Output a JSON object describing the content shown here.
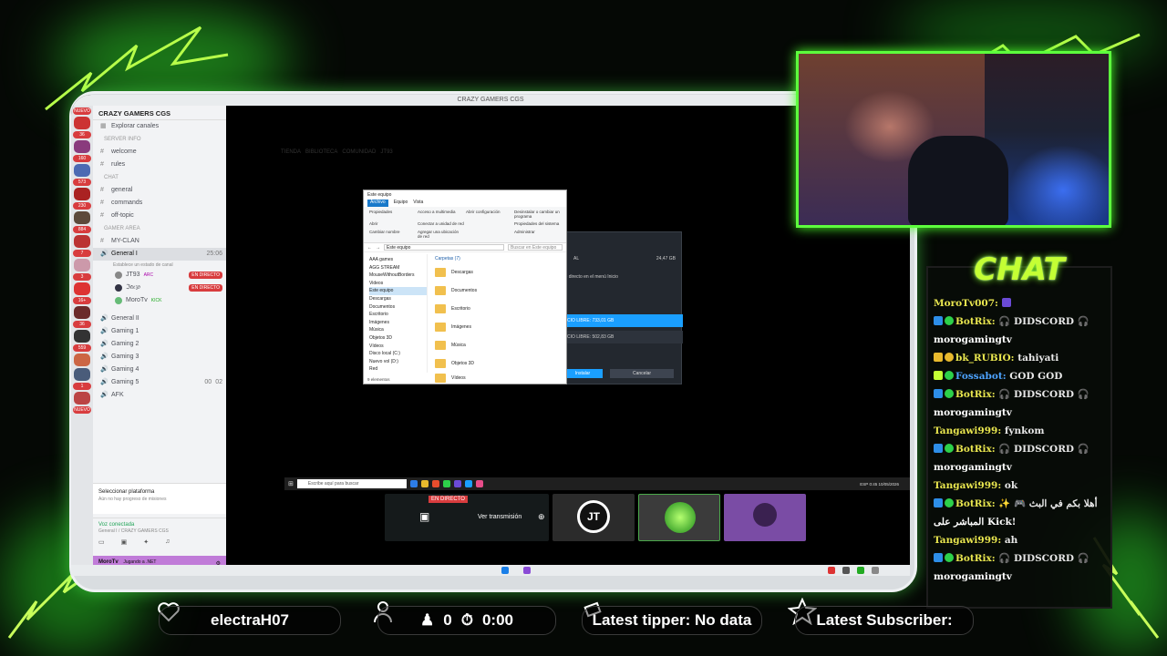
{
  "window_title": "CRAZY GAMERS CGS",
  "discord": {
    "rail_badges": [
      "NUEVO",
      "36",
      "160",
      "573",
      "230",
      "884",
      "7",
      "3",
      "16+",
      "36",
      "559",
      "1",
      "NUEVO"
    ],
    "server_name": "CRAZY GAMERS CGS",
    "explore": "Explorar canales",
    "channels": [
      {
        "kind": "cat",
        "label": "SERVER INFO"
      },
      {
        "kind": "text",
        "label": "welcome"
      },
      {
        "kind": "text",
        "label": "rules"
      },
      {
        "kind": "cat",
        "label": "CHAT"
      },
      {
        "kind": "text",
        "label": "general"
      },
      {
        "kind": "text",
        "label": "commands"
      },
      {
        "kind": "text",
        "label": "off-topic"
      },
      {
        "kind": "cat",
        "label": "GAMER AREA"
      },
      {
        "kind": "text",
        "label": "MY-CLAN"
      }
    ],
    "active_voice": {
      "label": "General I",
      "time": "25:06",
      "sub": "Establece un estado de canal"
    },
    "voice_users": [
      {
        "name": "JT93",
        "tag": "ARC",
        "live": "EN DIRECTO"
      },
      {
        "name": "ℑ𝔞𝔢𝔷𝔬",
        "tag": "",
        "live": "EN DIRECTO"
      },
      {
        "name": "MoroTv",
        "tag": "KICK",
        "live": ""
      }
    ],
    "voice_channels": [
      "General II",
      "Gaming 1",
      "Gaming 2",
      "Gaming 3",
      "Gaming 4",
      "Gaming 5",
      "AFK"
    ],
    "gaming5_counts": [
      "00",
      "02"
    ],
    "platform_title": "Seleccionar plataforma",
    "platform_sub": "Aún no hay progreso de misiones",
    "voice_connected": "Voz conectada",
    "voice_path": "General I / CRAZY GAMERS CGS",
    "user_name": "MoroTv",
    "user_status": "Jugando a .NET"
  },
  "explorer": {
    "title": "Este equipo",
    "tabs": [
      "Archivo",
      "Equipo",
      "Vista"
    ],
    "ribbon": [
      "Propiedades",
      "Abrir",
      "Cambiar nombre",
      "Acceso a multimedia",
      "Conectar a unidad de red",
      "Agregar una ubicación de red",
      "Abrir configuración",
      "Desinstalar o cambiar un programa",
      "Propiedades del sistema",
      "Administrar"
    ],
    "address": "Este equipo",
    "search": "Buscar en Este equipo",
    "nav": [
      "AAA games",
      "AGG STREAM",
      "MouseWithoutBorders",
      "Videos",
      "Este equipo",
      "Descargas",
      "Documentos",
      "Escritorio",
      "Imágenes",
      "Música",
      "Objetos 3D",
      "Vídeos",
      "Disco local (C:)",
      "Nuevo vol (D:)",
      "Red"
    ],
    "folders_header": "Carpetas (7)",
    "folders": [
      "Descargas",
      "Documentos",
      "Escritorio",
      "Imágenes",
      "Música",
      "Objetos 3D",
      "Vídeos"
    ],
    "status": "9 elementos"
  },
  "steam": {
    "size": "24,47 GB",
    "option": "Crear acceso directo en el menú Inicio",
    "free1": "ESPACIO LIBRE: 733,01 GB",
    "free2": "ESPACIO LIBRE: 502,83 GB",
    "install": "Instalar",
    "cancel": "Cancelar",
    "partial_label": "AL"
  },
  "ghost_bar": [
    "TIENDA",
    "BIBLIOTECA",
    "COMUNIDAD",
    "JT93"
  ],
  "taskbar": {
    "search": "Escribe aquí para buscar",
    "lang": "ESP",
    "time": "0:45",
    "date": "10/05/2026"
  },
  "thumbs": {
    "live_badge": "EN DIRECTO",
    "watch": "Ver transmisión",
    "logo": "JT"
  },
  "chat": {
    "title": "CHAT",
    "messages": [
      {
        "user": "MoroTv007:",
        "text": "",
        "line2": "",
        "icon": "",
        "icon_color": "#6b4bd6"
      },
      {
        "user": "BotRix:",
        "text": "🎧 DIDSCORD 🎧",
        "line2": "morogamingtv",
        "icon": "bot",
        "icon_color": "#2d8ee8"
      },
      {
        "user": "bk_RUBIO:",
        "text": "tahiyati",
        "line2": "",
        "icon": "crown",
        "icon_color": "#e8b92d"
      },
      {
        "user": "Fossabot:",
        "text": "GOD GOD",
        "line2": "",
        "icon": "bot",
        "icon_color": "#2dd04a"
      },
      {
        "user": "BotRix:",
        "text": "🎧 DIDSCORD 🎧",
        "line2": "morogamingtv",
        "icon": "bot",
        "icon_color": "#2d8ee8"
      },
      {
        "user": "Tangawi999:",
        "text": "fynkom",
        "line2": "",
        "icon": "",
        "icon_color": ""
      },
      {
        "user": "BotRix:",
        "text": "🎧 DIDSCORD 🎧",
        "line2": "morogamingtv",
        "icon": "bot",
        "icon_color": "#2d8ee8"
      },
      {
        "user": "Tangawi999:",
        "text": "ok",
        "line2": "",
        "icon": "",
        "icon_color": ""
      },
      {
        "user": "BotRix:",
        "text": "✨ 🎮 أهلا بكم في البث",
        "line2": "المباشر على Kick!",
        "icon": "bot",
        "icon_color": "#2d8ee8"
      },
      {
        "user": "Tangawi999:",
        "text": "ah",
        "line2": "",
        "icon": "",
        "icon_color": ""
      },
      {
        "user": "BotRix:",
        "text": "🎧 DIDSCORD 🎧",
        "line2": "morogamingtv",
        "icon": "bot",
        "icon_color": "#2d8ee8"
      }
    ]
  },
  "bottom_bar": {
    "latest_follower": "electraH07",
    "counter": "0",
    "timer": "0:00",
    "latest_tipper_label": "Latest tipper: No data",
    "latest_subscriber_label": "Latest Subscriber:"
  },
  "colors": {
    "neon": "#5dff3d",
    "chat_title": "#c4ff34",
    "live_red": "#d83c3e",
    "steam_blue": "#1a9fff"
  }
}
